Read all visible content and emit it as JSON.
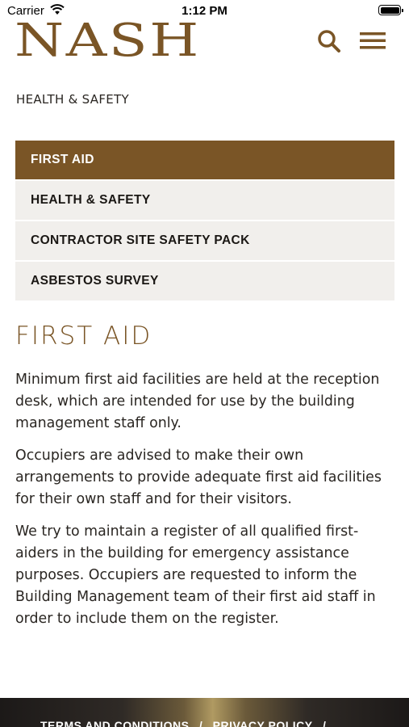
{
  "status_bar": {
    "carrier": "Carrier",
    "time": "1:12 PM"
  },
  "header": {
    "logo_text": "NASH",
    "accent_color": "#7a5526",
    "icons": [
      "search-icon",
      "menu-icon"
    ]
  },
  "breadcrumb": "HEALTH & SAFETY",
  "subnav": {
    "items": [
      {
        "label": "FIRST AID",
        "active": true
      },
      {
        "label": "HEALTH & SAFETY",
        "active": false
      },
      {
        "label": "CONTRACTOR SITE SAFETY PACK",
        "active": false
      },
      {
        "label": "ASBESTOS SURVEY",
        "active": false
      }
    ]
  },
  "main": {
    "title": "FIRST AID",
    "paragraphs": [
      "Minimum first aid facilities are held at the reception desk, which are intended for use by the building management staff only.",
      "Occupiers are advised to make their own arrangements to provide adequate first aid facilities for their own staff and for their visitors.",
      "We try to maintain a register of all qualified first-aiders in the building for emergency assistance purposes. Occupiers are requested to inform the Building Management team of their first aid staff in order to include them on the register."
    ]
  },
  "footer": {
    "links": [
      "TERMS AND CONDITIONS",
      "/",
      "PRIVACY POLICY",
      "/"
    ]
  }
}
